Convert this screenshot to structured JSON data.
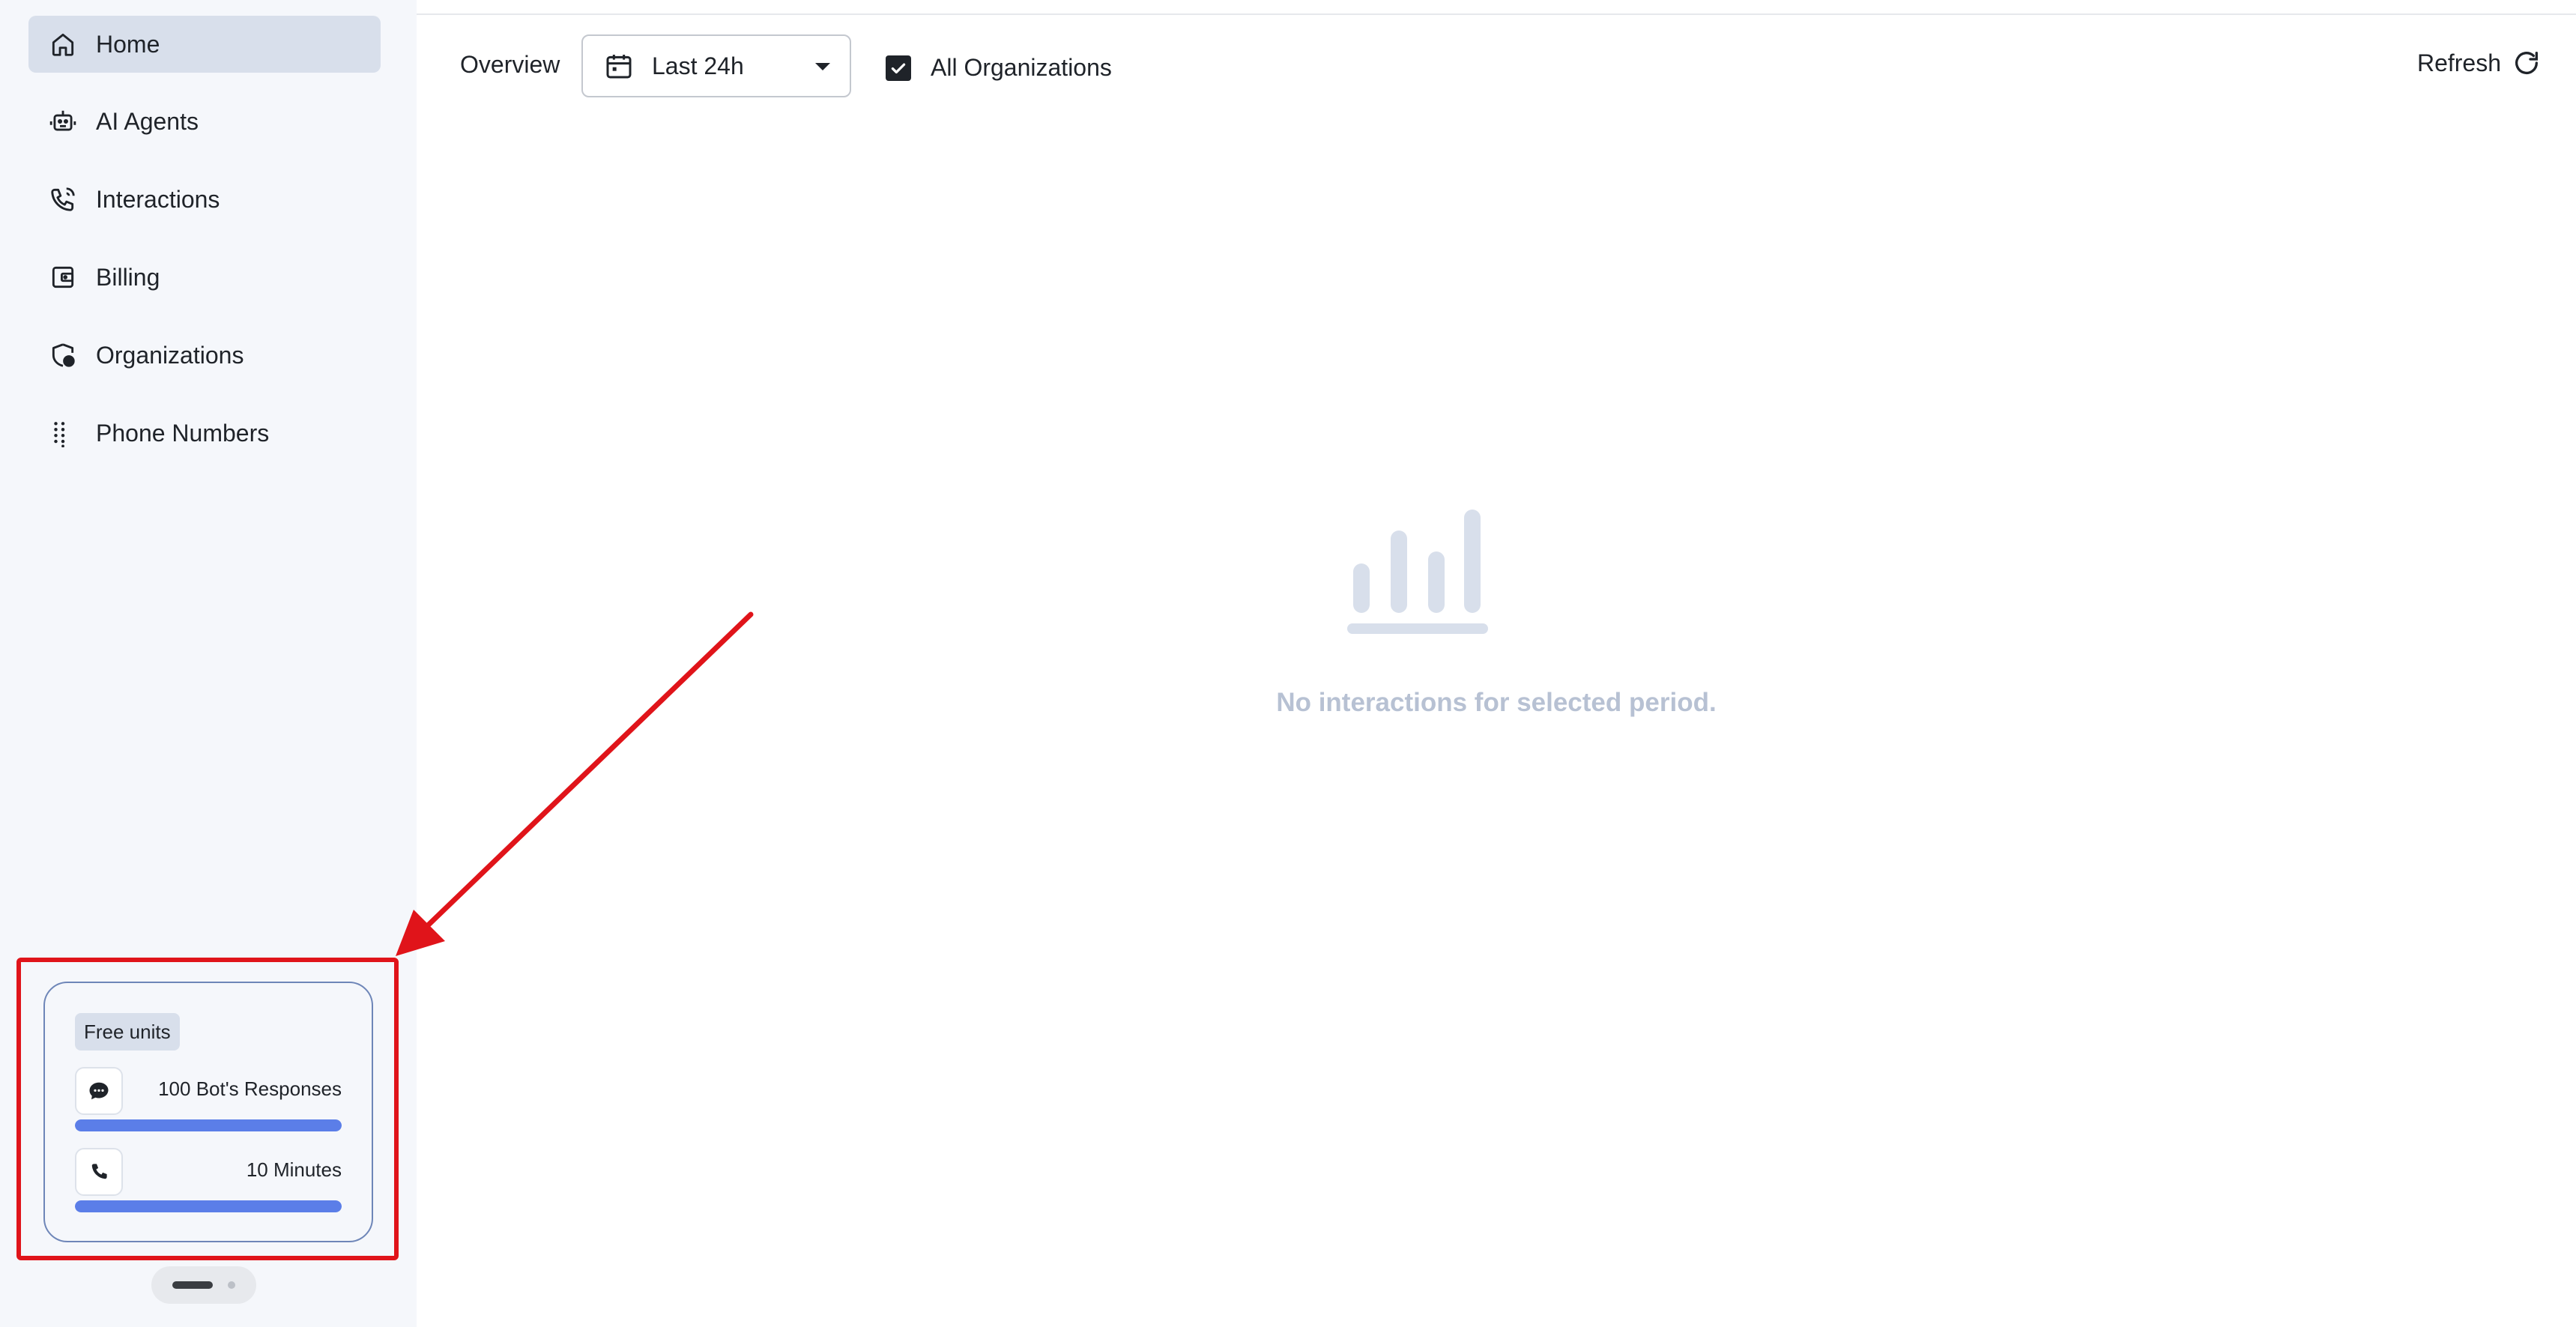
{
  "sidebar": {
    "items": [
      {
        "label": "Home",
        "icon": "home-icon",
        "active": true
      },
      {
        "label": "AI Agents",
        "icon": "robot-icon",
        "active": false
      },
      {
        "label": "Interactions",
        "icon": "phone-interactions-icon",
        "active": false
      },
      {
        "label": "Billing",
        "icon": "wallet-icon",
        "active": false
      },
      {
        "label": "Organizations",
        "icon": "shield-org-icon",
        "active": false
      },
      {
        "label": "Phone Numbers",
        "icon": "dialpad-icon",
        "active": false
      }
    ],
    "units_card": {
      "tag": "Free units",
      "bot_responses": {
        "label": "100 Bot's Responses",
        "icon": "chat-bubble-icon",
        "progress": 1.0
      },
      "minutes": {
        "label": "10 Minutes",
        "icon": "phone-icon",
        "progress": 1.0
      }
    }
  },
  "toolbar": {
    "overview_label": "Overview",
    "range_value": "Last 24h",
    "all_orgs_label": "All Organizations",
    "all_orgs_checked": true,
    "refresh_label": "Refresh"
  },
  "empty_state": {
    "message": "No interactions for selected period.",
    "icon": "bar-chart-icon"
  },
  "colors": {
    "sidebar_bg": "#f5f7fb",
    "active_item_bg": "#d8dfeb",
    "progress_fill": "#5b7ee8",
    "empty_text": "#b7c1d3",
    "annotation": "#e0141a"
  }
}
